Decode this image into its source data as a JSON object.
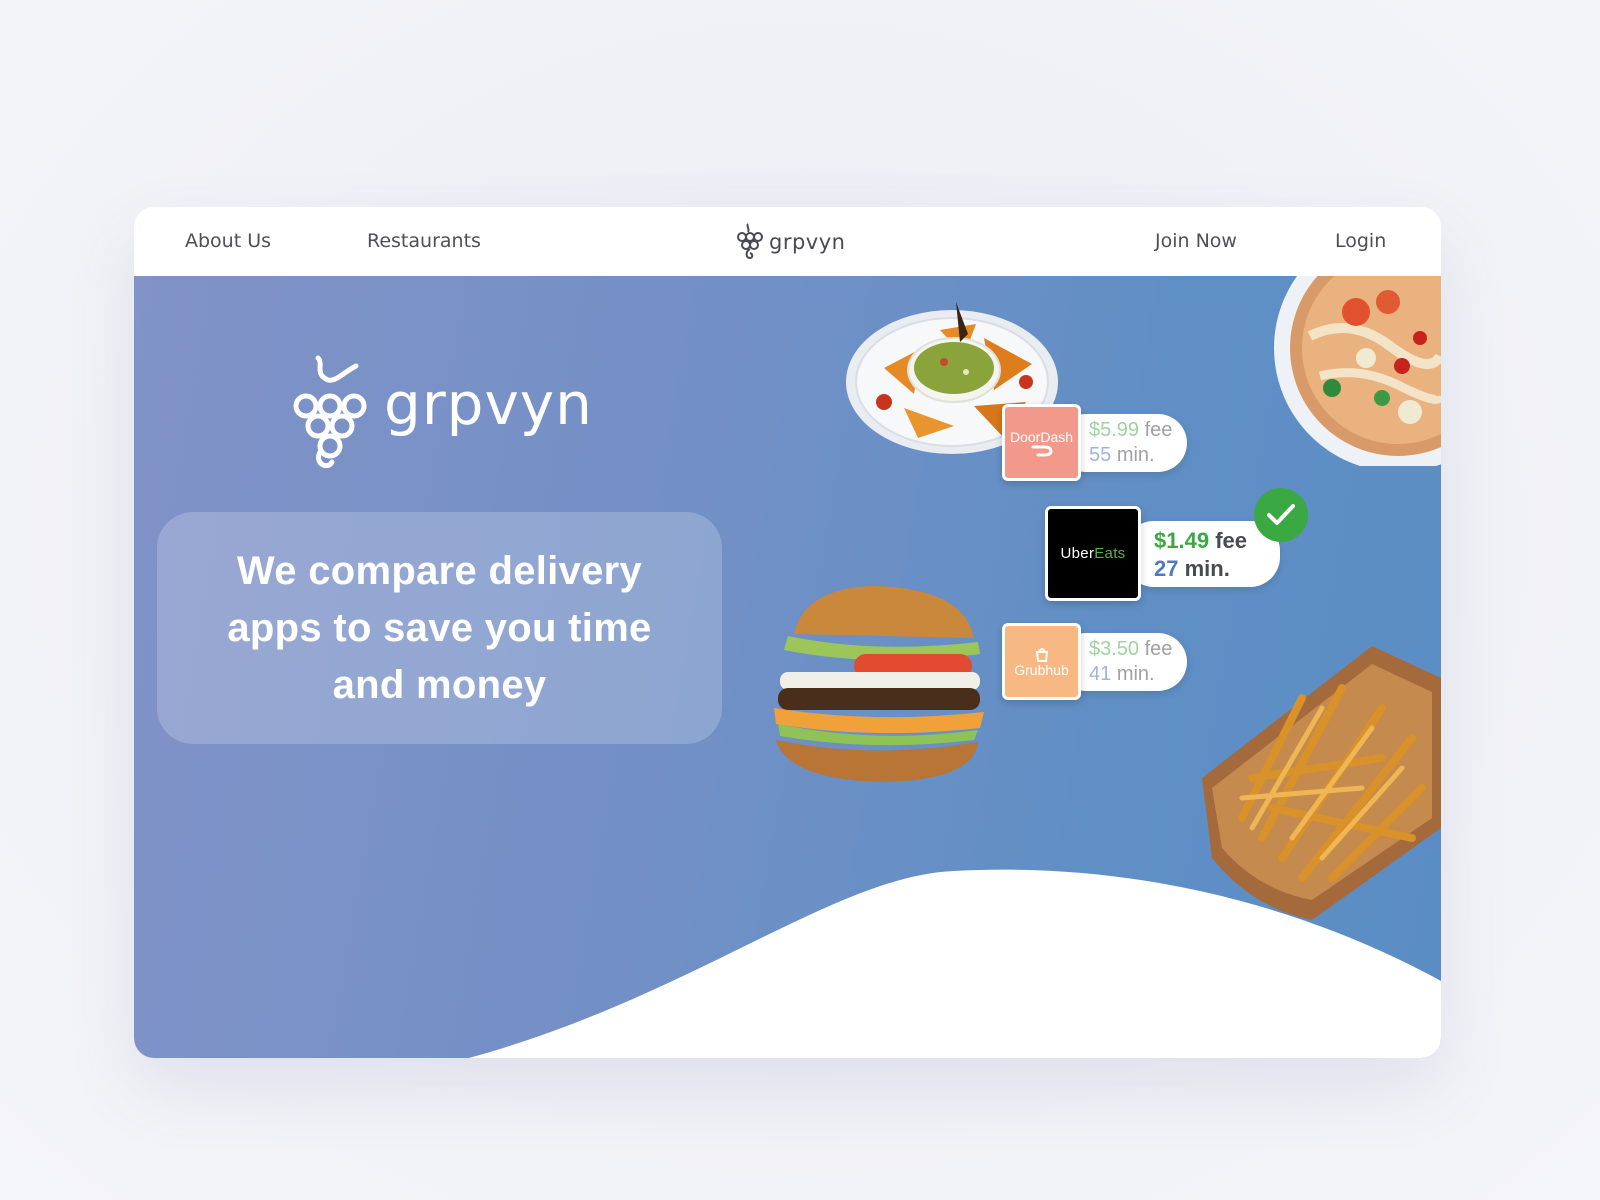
{
  "nav": {
    "about_label": "About Us",
    "restaurants_label": "Restaurants",
    "brand": "grpvyn",
    "join_label": "Join Now",
    "login_label": "Login"
  },
  "hero": {
    "brand": "grpvyn",
    "tagline": "We compare delivery apps to save you time and money"
  },
  "apps": [
    {
      "name": "DoorDash",
      "fee_amount": "$5.99",
      "fee_word": "fee",
      "time_value": "55",
      "time_unit": "min.",
      "tile_color": "#f2998b",
      "selected": false
    },
    {
      "name_part1": "Uber",
      "name_part2": "Eats",
      "fee_amount": "$1.49",
      "fee_word": "fee",
      "time_value": "27",
      "time_unit": "min.",
      "tile_color": "#000000",
      "selected": true
    },
    {
      "name": "Grubhub",
      "fee_amount": "$3.50",
      "fee_word": "fee",
      "time_value": "41",
      "time_unit": "min.",
      "tile_color": "#f7b883",
      "selected": false
    }
  ],
  "colors": {
    "hero_gradient_start": "#8193c8",
    "hero_gradient_end": "#5a8dc4",
    "fee_green": "#3aa843",
    "fee_green_muted": "#9fd3a0",
    "time_blue": "#4f79c2",
    "time_blue_muted": "#9fb3e0",
    "check_green": "#3aa843"
  },
  "icons": {
    "brand_logo": "grape-cluster-icon",
    "selected_marker": "check-icon",
    "doordash_logo": "doordash-swoosh-icon",
    "grubhub_logo": "grubhub-bag-icon"
  }
}
